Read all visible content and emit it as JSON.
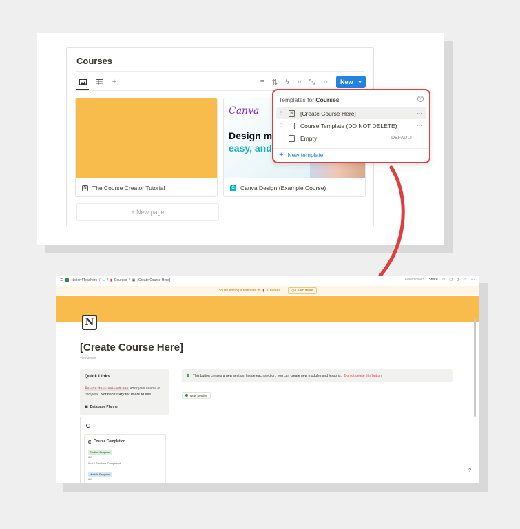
{
  "top": {
    "db_title": "Courses",
    "new_button": "New",
    "new_page": "+ New page",
    "cards": [
      {
        "title": "The Course Creator Tutorial",
        "color": "#f8bc4d"
      },
      {
        "title": "Canva Design (Example Course)",
        "logo": "Canva",
        "headline1": "Design m",
        "headline2": "easy, and"
      }
    ],
    "templates": {
      "heading_prefix": "Templates for",
      "heading_db": "Courses",
      "rows": [
        {
          "name": "[Create Course Here]",
          "badge": ""
        },
        {
          "name": "Course Template (DO NOT DELETE)",
          "badge": ""
        },
        {
          "name": "Empty",
          "badge": "DEFAULT"
        }
      ],
      "new_template": "New template",
      "more": "···"
    }
  },
  "bottom": {
    "breadcrumbs": [
      "Notion4Teachers",
      "...",
      "Courses",
      "[Create Course Here]"
    ],
    "edited": "Edited Nov 5",
    "share": "Share",
    "banner_text": "You're editing a template in",
    "banner_db": "Courses.",
    "learn_more": "Learn more",
    "page_title": "[Create Course Here]",
    "view_details": "View details",
    "quick_links": {
      "heading": "Quick Links",
      "code": "Delete this callout box",
      "text": "once your course is complete.",
      "italic": "Not necessary for users to see.",
      "link": "Database Planner"
    },
    "completion": {
      "heading": "Course Completion",
      "section_tag": "Section Progress",
      "section_pct": "0%",
      "section_sub": "0 of 0 Sections Completed.",
      "module_tag": "Module Progress",
      "module_pct": "0%"
    },
    "callout": {
      "text": "This button creates a new section. Inside each section, you can create new modules and lessons.",
      "warning": "Do not delete this button!"
    },
    "new_section": "New Section",
    "help": "?"
  },
  "colors": {
    "accent": "#2383e2",
    "highlight": "#e03e3e",
    "cover": "#f8bc4d"
  }
}
